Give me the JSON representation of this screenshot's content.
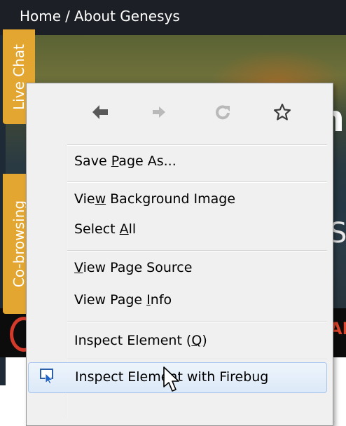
{
  "breadcrumb": {
    "home": "Home",
    "separator": "/",
    "current": "About Genesys"
  },
  "side_tabs": {
    "live_chat": "Live Chat",
    "cobrowsing": "Co-browsing"
  },
  "background_fragments": {
    "hero_letter": "n",
    "hero_suffix": "Si",
    "red_text": "AI"
  },
  "context_menu": {
    "nav": {
      "back_icon": "arrow-left-icon",
      "forward_icon": "arrow-right-icon",
      "reload_icon": "reload-icon",
      "bookmark_icon": "star-icon"
    },
    "items": {
      "save_page_as": {
        "before": "Save ",
        "accel": "P",
        "after": "age As..."
      },
      "view_background_image": {
        "before": "Vie",
        "accel": "w",
        "after": " Background Image"
      },
      "select_all": {
        "before": "Select ",
        "accel": "A",
        "after": "ll"
      },
      "view_page_source": {
        "before": "",
        "accel": "V",
        "after": "iew Page Source"
      },
      "view_page_info": {
        "before": "View Page ",
        "accel": "I",
        "after": "nfo"
      },
      "inspect_element": {
        "before": "Inspect Element (",
        "accel": "Q",
        "after": ")"
      },
      "inspect_with_firebug": {
        "label": "Inspect Element with Firebug",
        "icon": "firebug-inspect-icon"
      }
    }
  }
}
